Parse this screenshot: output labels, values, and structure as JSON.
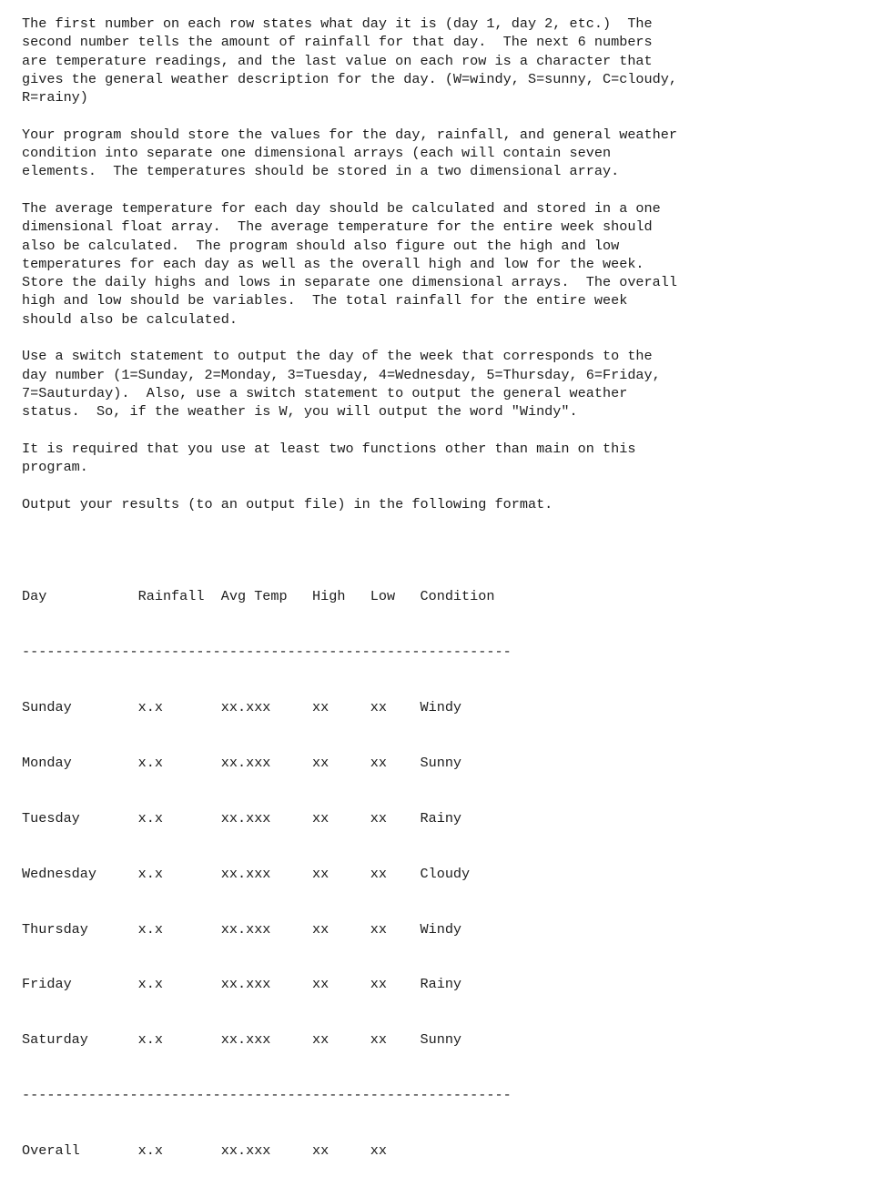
{
  "document": {
    "paragraphs": [
      "The first number on each row states what day it is (day 1, day 2, etc.)  The\nsecond number tells the amount of rainfall for that day.  The next 6 numbers\nare temperature readings, and the last value on each row is a character that\ngives the general weather description for the day. (W=windy, S=sunny, C=cloudy,\nR=rainy)",
      "Your program should store the values for the day, rainfall, and general weather\ncondition into separate one dimensional arrays (each will contain seven\nelements.  The temperatures should be stored in a two dimensional array.",
      "The average temperature for each day should be calculated and stored in a one\ndimensional float array.  The average temperature for the entire week should\nalso be calculated.  The program should also figure out the high and low\ntemperatures for each day as well as the overall high and low for the week.\nStore the daily highs and lows in separate one dimensional arrays.  The overall\nhigh and low should be variables.  The total rainfall for the entire week\nshould also be calculated.",
      "Use a switch statement to output the day of the week that corresponds to the\nday number (1=Sunday, 2=Monday, 3=Tuesday, 4=Wednesday, 5=Thursday, 6=Friday,\n7=Sauturday).  Also, use a switch statement to output the general weather\nstatus.  So, if the weather is W, you will output the word \"Windy\".",
      "It is required that you use at least two functions other than main on this\nprogram.",
      "Output your results (to an output file) in the following format."
    ]
  },
  "output_table": {
    "header_line": "Day           Rainfall  Avg Temp   High   Low   Condition",
    "separator": "-----------------------------------------------------------",
    "columns": [
      "Day",
      "Rainfall",
      "Avg Temp",
      "High",
      "Low",
      "Condition"
    ],
    "rows": [
      {
        "line": "Sunday        x.x       xx.xxx     xx     xx    Windy",
        "day": "Sunday",
        "rainfall": "x.x",
        "avg_temp": "xx.xxx",
        "high": "xx",
        "low": "xx",
        "condition": "Windy"
      },
      {
        "line": "Monday        x.x       xx.xxx     xx     xx    Sunny",
        "day": "Monday",
        "rainfall": "x.x",
        "avg_temp": "xx.xxx",
        "high": "xx",
        "low": "xx",
        "condition": "Sunny"
      },
      {
        "line": "Tuesday       x.x       xx.xxx     xx     xx    Rainy",
        "day": "Tuesday",
        "rainfall": "x.x",
        "avg_temp": "xx.xxx",
        "high": "xx",
        "low": "xx",
        "condition": "Rainy"
      },
      {
        "line": "Wednesday     x.x       xx.xxx     xx     xx    Cloudy",
        "day": "Wednesday",
        "rainfall": "x.x",
        "avg_temp": "xx.xxx",
        "high": "xx",
        "low": "xx",
        "condition": "Cloudy"
      },
      {
        "line": "Thursday      x.x       xx.xxx     xx     xx    Windy",
        "day": "Thursday",
        "rainfall": "x.x",
        "avg_temp": "xx.xxx",
        "high": "xx",
        "low": "xx",
        "condition": "Windy"
      },
      {
        "line": "Friday        x.x       xx.xxx     xx     xx    Rainy",
        "day": "Friday",
        "rainfall": "x.x",
        "avg_temp": "xx.xxx",
        "high": "xx",
        "low": "xx",
        "condition": "Rainy"
      },
      {
        "line": "Saturday      x.x       xx.xxx     xx     xx    Sunny",
        "day": "Saturday",
        "rainfall": "x.x",
        "avg_temp": "xx.xxx",
        "high": "xx",
        "low": "xx",
        "condition": "Sunny"
      }
    ],
    "separator_bottom": "-----------------------------------------------------------",
    "total_row": {
      "line": "Overall       x.x       xx.xxx     xx     xx",
      "day": "Overall",
      "rainfall": "x.x",
      "avg_temp": "xx.xxx",
      "high": "xx",
      "low": "xx",
      "condition": ""
    }
  }
}
